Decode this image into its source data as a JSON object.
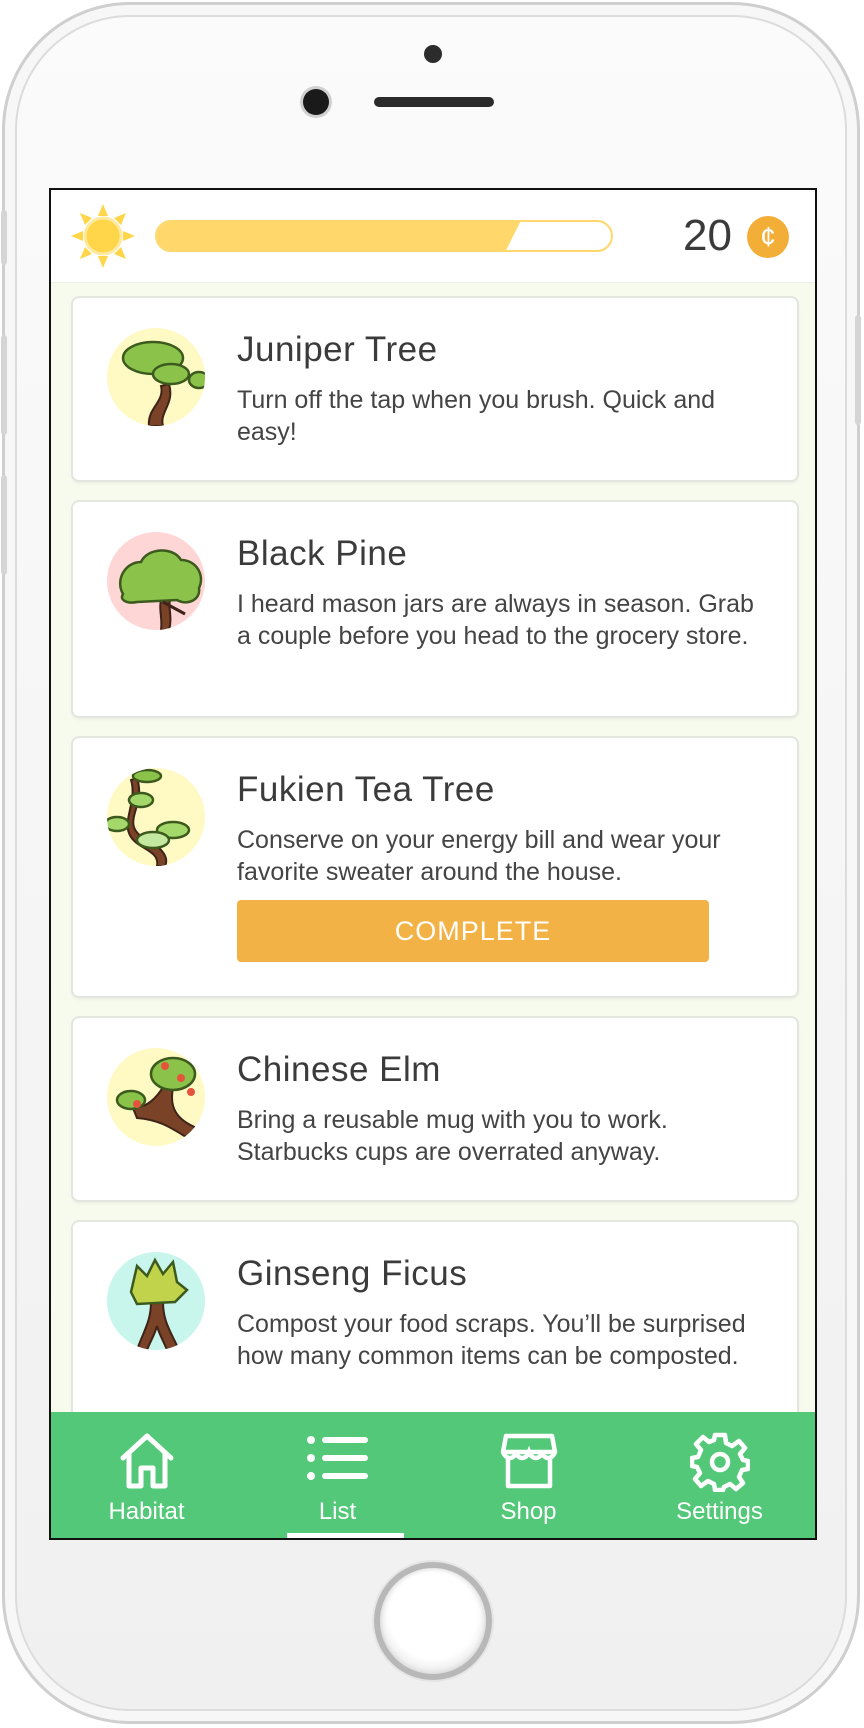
{
  "header": {
    "coins": "20",
    "coin_symbol": "¢",
    "progress_fraction": 0.8
  },
  "tasks": [
    {
      "name": "Juniper Tree",
      "desc": "Turn off the tap when you brush. Quick and easy!",
      "thumb_bg": "#fff9c4"
    },
    {
      "name": "Black Pine",
      "desc": "I heard mason jars are always in season. Grab a couple before you head to the grocery store.",
      "thumb_bg": "#ffd6d6"
    },
    {
      "name": "Fukien Tea Tree",
      "desc": "Conserve on your energy bill and wear your favorite sweater around the house.",
      "thumb_bg": "#fff9c4",
      "action": "COMPLETE"
    },
    {
      "name": "Chinese Elm",
      "desc": "Bring a reusable mug with you to work. Starbucks cups are overrated anyway.",
      "thumb_bg": "#fff9c4"
    },
    {
      "name": "Ginseng Ficus",
      "desc": "Compost your food scraps. You’ll be surprised how many common items can be composted.",
      "thumb_bg": "#c8f5ec"
    }
  ],
  "tabs": [
    {
      "label": "Habitat",
      "icon": "home-icon"
    },
    {
      "label": "List",
      "icon": "list-icon",
      "active": true
    },
    {
      "label": "Shop",
      "icon": "shop-icon"
    },
    {
      "label": "Settings",
      "icon": "gear-icon"
    }
  ],
  "colors": {
    "accent_green": "#52c878",
    "progress_yellow": "#ffd76a",
    "button_orange": "#f2b245",
    "coin_orange": "#f3ae38"
  }
}
